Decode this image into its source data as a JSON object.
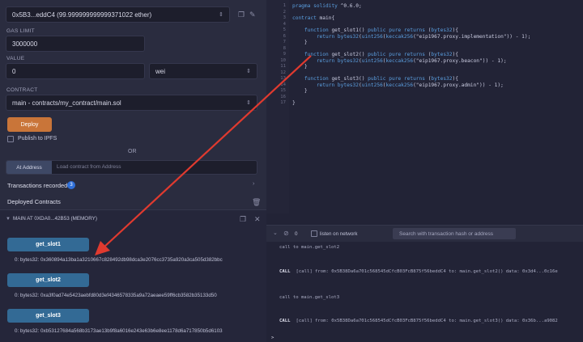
{
  "run": {
    "account_value": "0x5B3...eddC4 (99.999999999999371022 ether)",
    "gas_limit_label": "GAS LIMIT",
    "gas_limit_value": "3000000",
    "value_label": "VALUE",
    "value_amount": "0",
    "value_unit": "wei",
    "contract_label": "CONTRACT",
    "contract_value": "main - contracts/my_contract/main.sol",
    "deploy_label": "Deploy",
    "publish_label": "Publish to IPFS",
    "or_label": "OR",
    "at_address_label": "At Address",
    "load_contract_placeholder": "Load contract from Address",
    "transactions_recorded_label": "Transactions recorded",
    "transactions_count": "3",
    "deployed_contracts_label": "Deployed Contracts",
    "instance_label": "MAIN AT 0XDA0...42B53 (MEMORY)",
    "functions": [
      {
        "name": "get_slot1",
        "output": "0: bytes32: 0x360894a13ba1a3210667c828492db98dca3e2076cc3735a920a3ca505d382bbc"
      },
      {
        "name": "get_slot2",
        "output": "0: bytes32: 0xa3f0ad74e5423aebfd80d3ef4346578335a9a72aeaee59ff6cb3582b35133d50"
      },
      {
        "name": "get_slot3",
        "output": "0: bytes32: 0xb53127684a568b3173ae13b9f8a6016e243e63b6e8ee1178d6a717850b5d6103"
      }
    ]
  },
  "editor": {
    "lines": [
      {
        "n": "1",
        "text": "pragma solidity ^0.6.0;"
      },
      {
        "n": "2",
        "text": ""
      },
      {
        "n": "3",
        "text": "contract main{"
      },
      {
        "n": "4",
        "text": ""
      },
      {
        "n": "5",
        "text": "    function get_slot1() public pure returns (bytes32){"
      },
      {
        "n": "6",
        "text": "        return bytes32(uint256(keccak256(\"eip1967.proxy.implementation\")) - 1);"
      },
      {
        "n": "7",
        "text": "    }"
      },
      {
        "n": "8",
        "text": ""
      },
      {
        "n": "9",
        "text": "    function get_slot2() public pure returns (bytes32){"
      },
      {
        "n": "10",
        "text": "        return bytes32(uint256(keccak256(\"eip1967.proxy.beacon\")) - 1);"
      },
      {
        "n": "11",
        "text": "    }"
      },
      {
        "n": "12",
        "text": ""
      },
      {
        "n": "13",
        "text": "    function get_slot3() public pure returns (bytes32){"
      },
      {
        "n": "14",
        "text": "        return bytes32(uint256(keccak256(\"eip1967.proxy.admin\")) - 1);"
      },
      {
        "n": "15",
        "text": "    }"
      },
      {
        "n": "16",
        "text": ""
      },
      {
        "n": "17",
        "text": "}"
      }
    ]
  },
  "terminal": {
    "pending_count": "0",
    "listen_label": "listen on network",
    "search_placeholder": "Search with transaction hash or address",
    "entries": [
      {
        "call": "call to main.get_slot2",
        "kind": "CALL",
        "detail": "[call] from: 0x5B38Da6a701c568545dCfcB03FcB875f56beddC4 to: main.get_slot2() data: 0x3d4...0c16e"
      },
      {
        "call": "call to main.get_slot3",
        "kind": "CALL",
        "detail": "[call] from: 0x5B38Da6a701c568545dCfcB03FcB875f56beddC4 to: main.get_slot3() data: 0x36b...a9082"
      }
    ],
    "prompt": ">"
  },
  "colors": {
    "accent_orange": "#c97539",
    "fn_button": "#336a95",
    "arrow": "#e03a2f",
    "badge": "#2f6fd8"
  }
}
